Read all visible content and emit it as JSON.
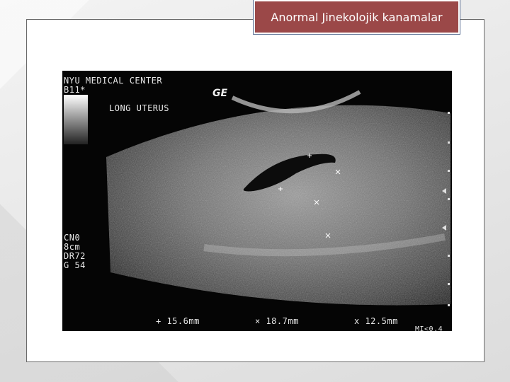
{
  "title": "Anormal Jinekolojik kanamalar",
  "ultrasound": {
    "header_line1": "NYU MEDICAL CENTER",
    "header_line2": "B11*",
    "logo": "GE",
    "study": "LONG UTERUS",
    "params": [
      "CN0",
      "8cm",
      "DR72",
      "G 54"
    ],
    "measurements": [
      "+ 15.6mm",
      "× 18.7mm",
      "x 12.5mm"
    ],
    "mi": "MI<0.4"
  }
}
